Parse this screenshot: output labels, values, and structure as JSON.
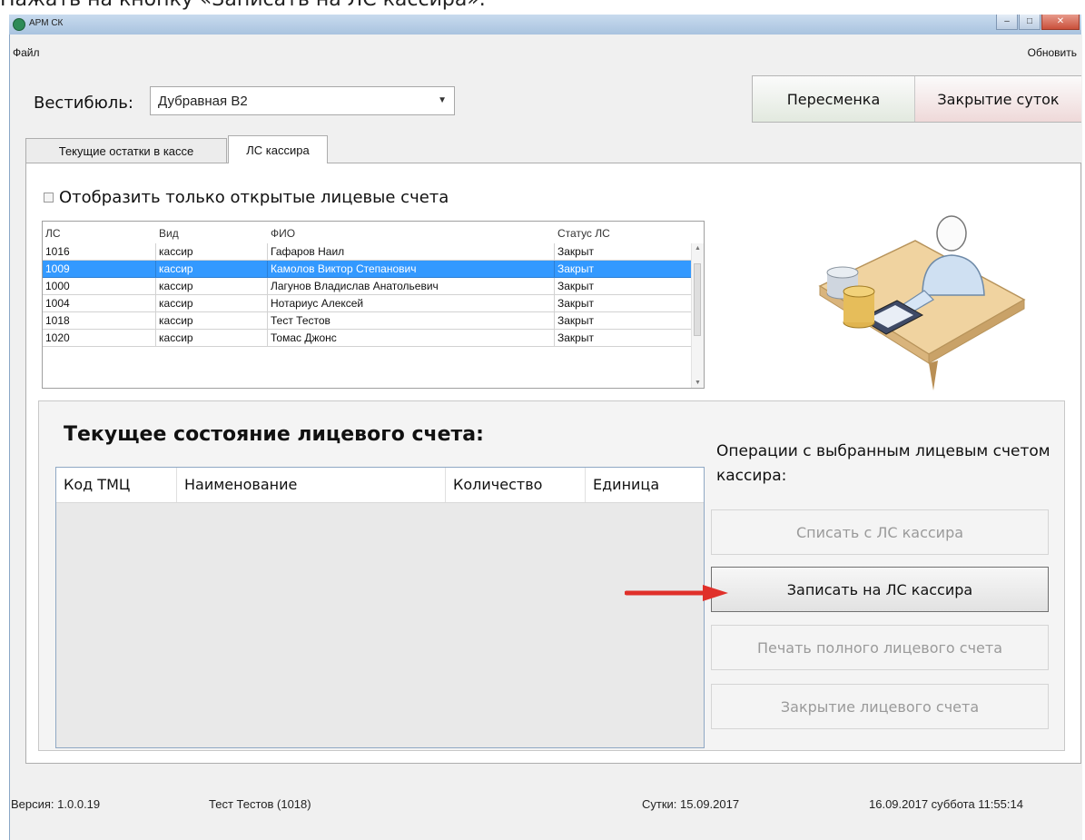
{
  "caption": "Нажать на кнопку «Записать на ЛС кассира».",
  "window": {
    "title": "АРМ СК",
    "controls": {
      "minimize": "–",
      "maximize": "□",
      "close": "✕"
    }
  },
  "menu": {
    "file": "Файл",
    "refresh": "Обновить"
  },
  "vestibule": {
    "label": "Вестибюль:",
    "selected": "Дубравная В2"
  },
  "header_buttons": {
    "shift_change": "Пересменка",
    "day_close": "Закрытие суток"
  },
  "tabs": [
    {
      "label": "Текущие остатки в кассе",
      "active": false
    },
    {
      "label": "ЛС кассира",
      "active": true
    }
  ],
  "filter": {
    "label": "Отобразить только открытые лицевые счета",
    "checked": false
  },
  "accounts": {
    "columns": [
      "ЛС",
      "Вид",
      "ФИО",
      "Статус ЛС"
    ],
    "rows": [
      {
        "ls": "1016",
        "kind": "кассир",
        "name": "Гафаров Наил",
        "status": "Закрыт"
      },
      {
        "ls": "1009",
        "kind": "кассир",
        "name": "Камолов Виктор Степанович",
        "status": "Закрыт",
        "selected": true
      },
      {
        "ls": "1000",
        "kind": "кассир",
        "name": "Лагунов Владислав Анатольевич",
        "status": "Закрыт"
      },
      {
        "ls": "1004",
        "kind": "кассир",
        "name": "Нотариус Алексей",
        "status": "Закрыт"
      },
      {
        "ls": "1018",
        "kind": "кассир",
        "name": "Тест Тестов",
        "status": "Закрыт"
      },
      {
        "ls": "1020",
        "kind": "кассир",
        "name": "Томас Джонс",
        "status": "Закрыт"
      }
    ]
  },
  "state": {
    "title": "Текущее состояние лицевого счета:",
    "columns": [
      "Код ТМЦ",
      "Наименование",
      "Количество",
      "Единица"
    ]
  },
  "operations": {
    "title": "Операции с выбранным лицевым счетом кассира:",
    "write_off": "Списать с ЛС кассира",
    "write_to": "Записать на ЛС кассира",
    "print_full": "Печать полного лицевого счета",
    "close_account": "Закрытие лицевого счета"
  },
  "statusbar": {
    "version": "Версия: 1.0.0.19",
    "user": "Тест Тестов  (1018)",
    "day": "Сутки: 15.09.2017",
    "datetime": "16.09.2017 суббота 11:55:14"
  },
  "colors": {
    "selection": "#3399ff",
    "arrow": "#e0302a"
  }
}
